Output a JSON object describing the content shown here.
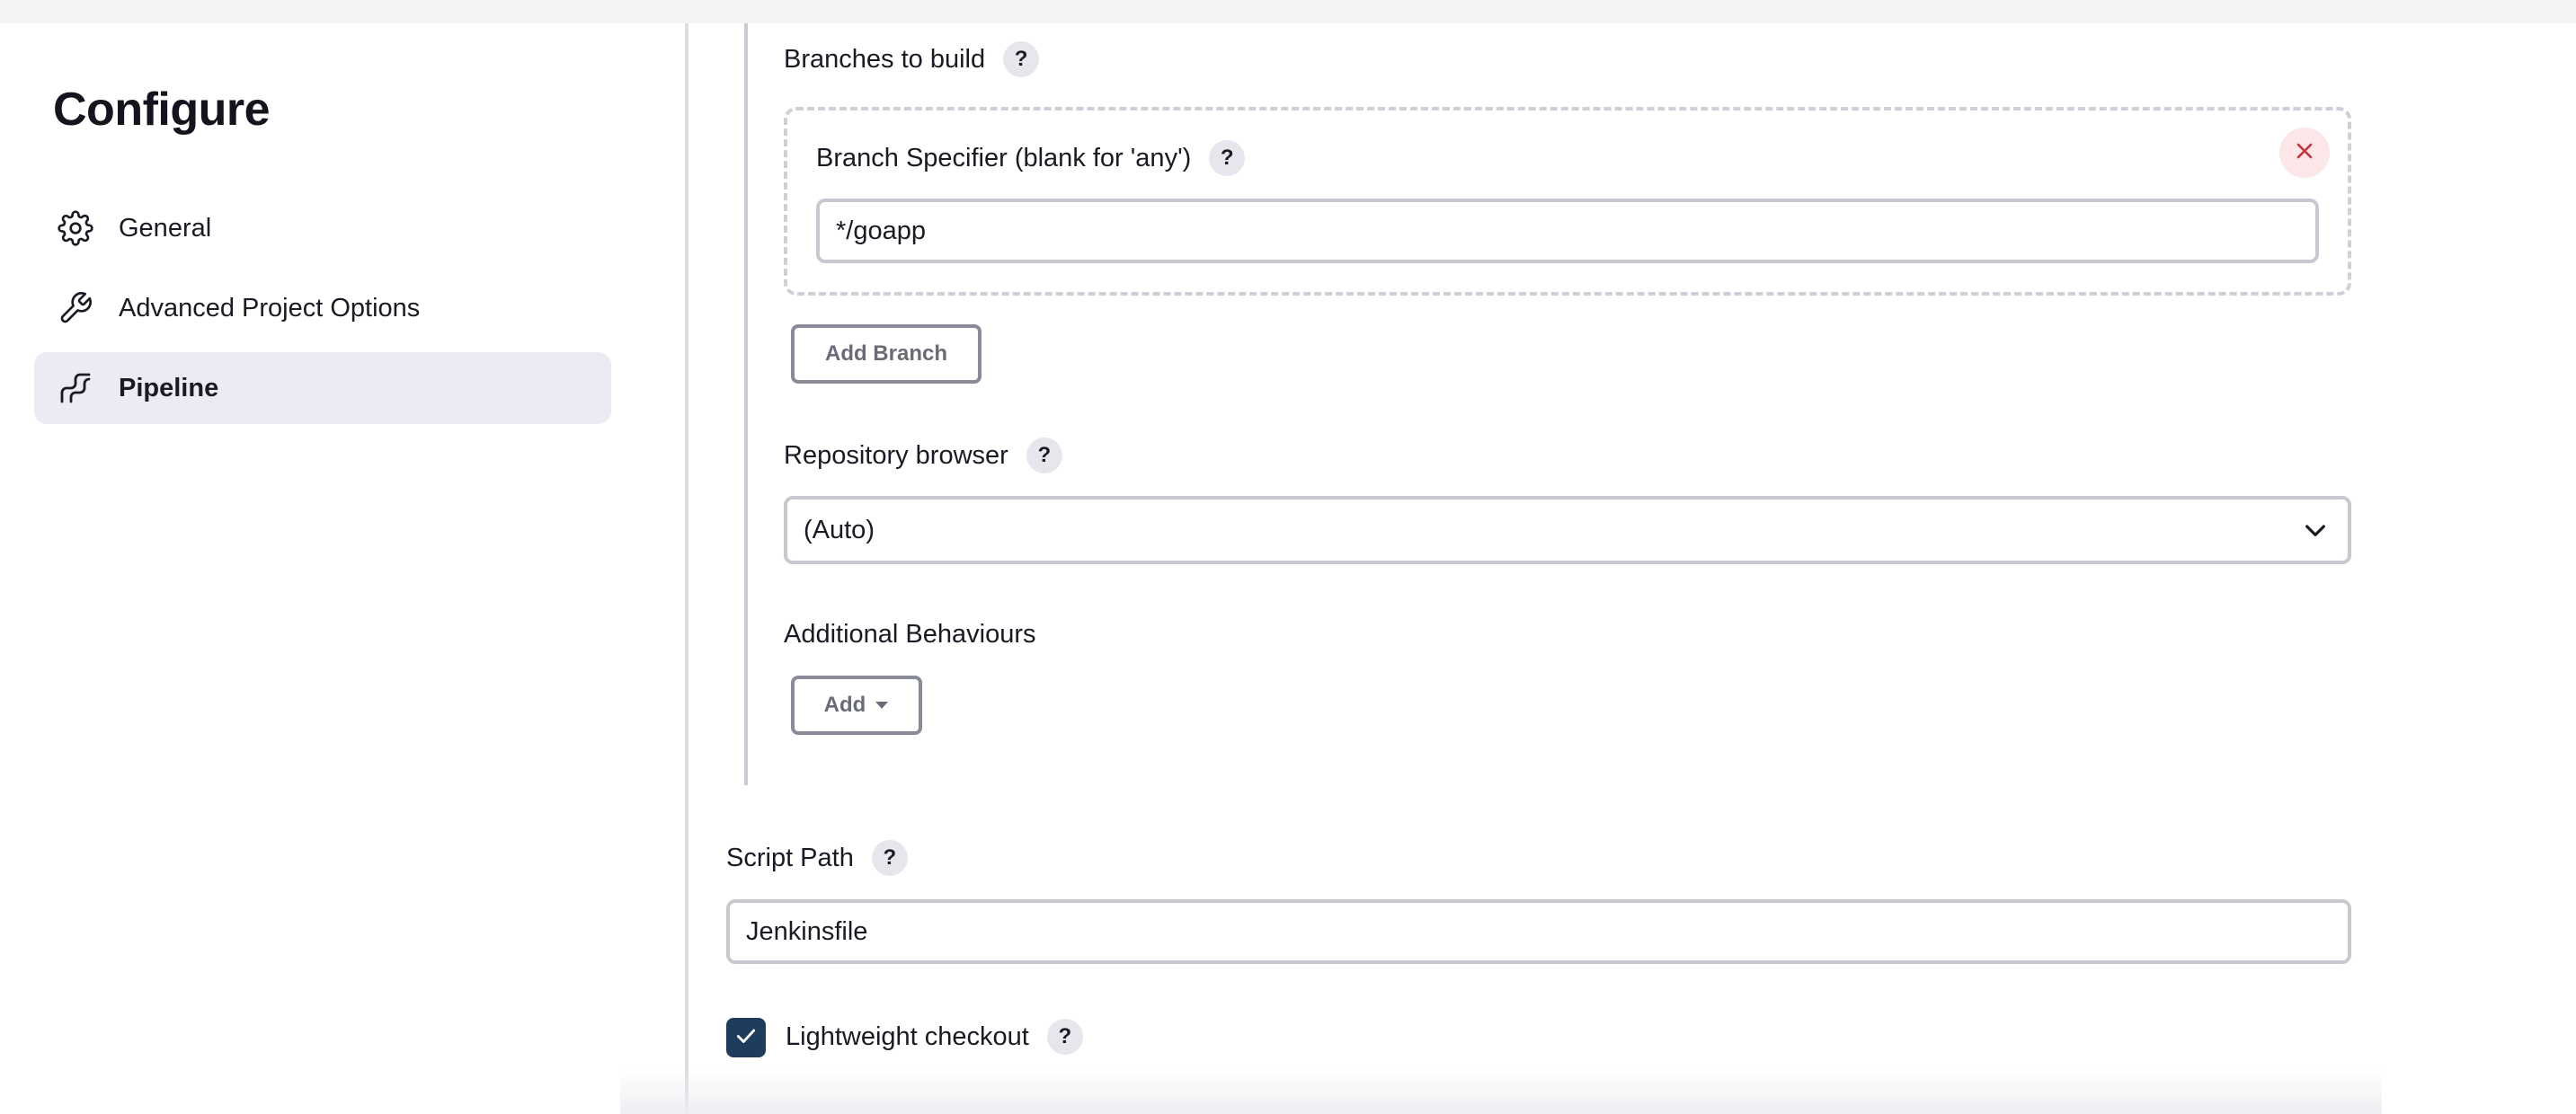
{
  "sidebar": {
    "title": "Configure",
    "items": [
      {
        "label": "General",
        "icon": "gear-icon",
        "active": false
      },
      {
        "label": "Advanced Project Options",
        "icon": "wrench-icon",
        "active": false
      },
      {
        "label": "Pipeline",
        "icon": "pipeline-icon",
        "active": true
      }
    ]
  },
  "branches": {
    "section_label": "Branches to build",
    "specifier_label": "Branch Specifier (blank for 'any')",
    "specifier_value": "*/goapp",
    "add_button": "Add Branch"
  },
  "repository_browser": {
    "label": "Repository browser",
    "selected": "(Auto)"
  },
  "additional_behaviours": {
    "label": "Additional Behaviours",
    "add_button": "Add"
  },
  "script_path": {
    "label": "Script Path",
    "value": "Jenkinsfile"
  },
  "lightweight_checkout": {
    "label": "Lightweight checkout",
    "checked": true
  },
  "help_glyph": "?",
  "colors": {
    "active_nav_bg": "#ebecf3",
    "checkbox_fill": "#1e3d5c",
    "remove_button_bg": "#fbe6e8",
    "remove_icon": "#c9303e"
  }
}
